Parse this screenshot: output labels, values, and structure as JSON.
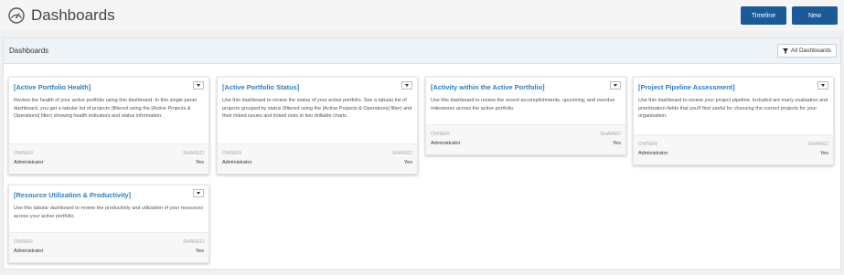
{
  "header": {
    "title": "Dashboards",
    "title_icon": "gauge-icon",
    "timeline_label": "Timeline",
    "new_label": "New"
  },
  "panel": {
    "title": "Dashboards",
    "filter_label": "All Dashboards",
    "filter_icon": "funnel-icon"
  },
  "cards": [
    {
      "title": "[Active Portfolio Health]",
      "desc": "Review the health of your active portfolio using this dashboard.  In this single panel dashboard, you get a tabular list of projects (filtered using the [Active Projects & Operations] filter) showing health indicators and status information.",
      "owner_label": "OWNER",
      "shared_label": "SHARED",
      "owner": "Administrator",
      "shared": "Yes"
    },
    {
      "title": "[Active Portfolio Status]",
      "desc": "Use this dashboard to review the status of your active portfolio.  See a tabular list of projects grouped by status (filtered using the [Active Projects & Operations] filter) and their linked issues and linked risks in two drillable charts.",
      "owner_label": "OWNER",
      "shared_label": "SHARED",
      "owner": "Administrator",
      "shared": "Yes"
    },
    {
      "title": "[Activity within the Active Portfolio]",
      "desc": "Use this dashboard to review the recent accomplishments, upcoming, and overdue milestones across the active portfolio.",
      "owner_label": "OWNER",
      "shared_label": "SHARED",
      "owner": "Administrator",
      "shared": "Yes"
    },
    {
      "title": "[Project Pipeline Assessment]",
      "desc": "Use this dashboard to review your project pipeline.  Included are many evaluation and prioritization fields that you'll find useful for choosing the correct projects for your organisation.",
      "owner_label": "OWNER",
      "shared_label": "SHARED",
      "owner": "Administrator",
      "shared": "Yes"
    },
    {
      "title": "[Resource Utilization & Productivity]",
      "desc": "Use this tabular dashboard to review the productivity and utilization of your resources across your active portfolio.",
      "owner_label": "OWNER",
      "shared_label": "SHARED",
      "owner": "Administrator",
      "shared": "Yes"
    }
  ],
  "colors": {
    "accent": "#1a5a96",
    "link": "#2a7ec5",
    "panel_header": "#eef3f8"
  }
}
